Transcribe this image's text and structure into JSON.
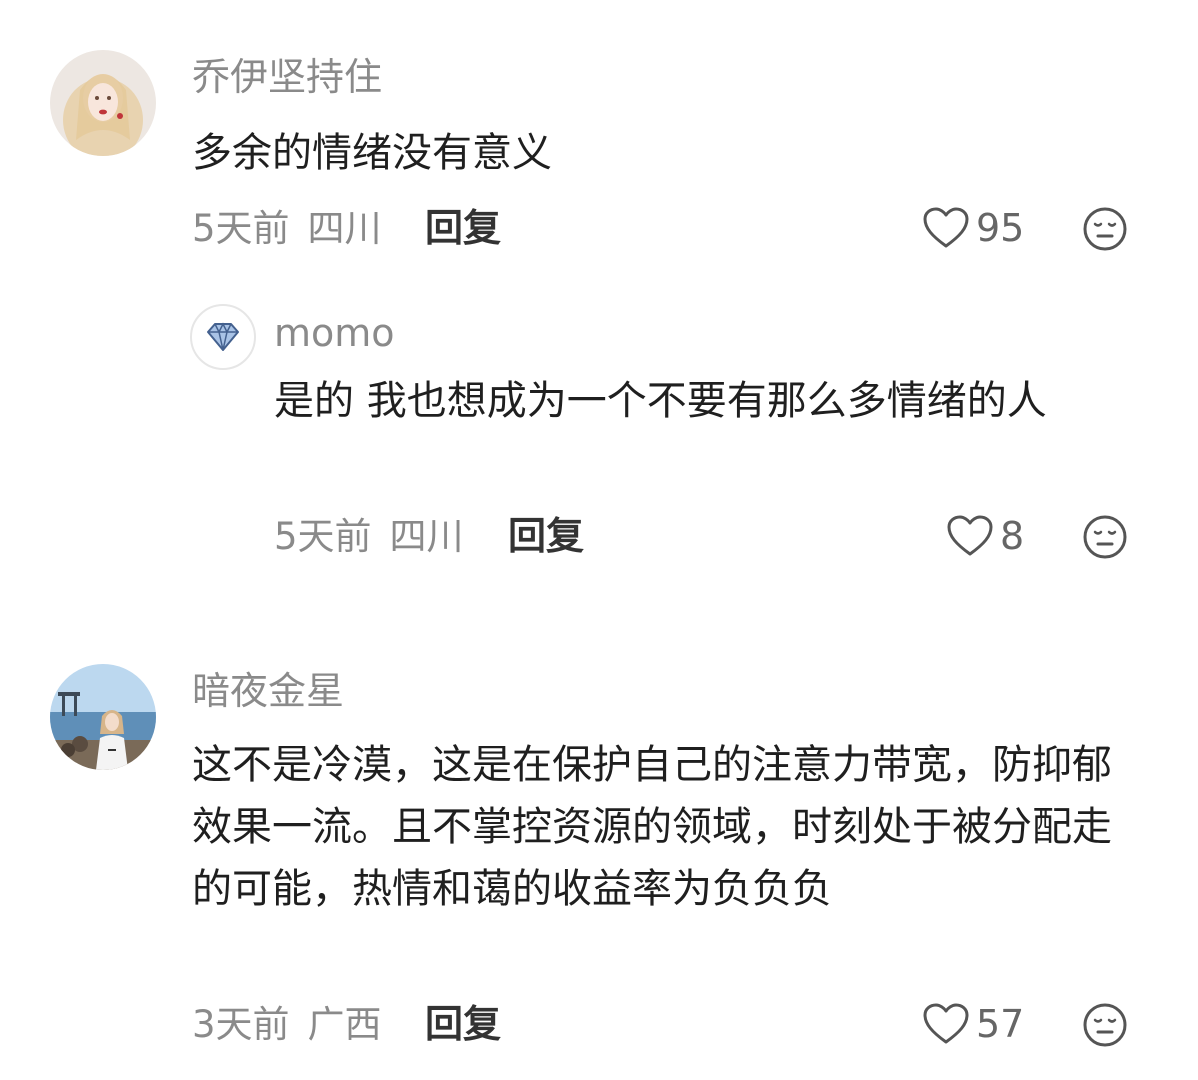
{
  "comments": [
    {
      "username": "乔伊坚持住",
      "text": "多余的情绪没有意义",
      "time": "5天前",
      "location": "四川",
      "reply_label": "回复",
      "likes": "95",
      "replies": [
        {
          "username": "momo",
          "text": "是的 我也想成为一个不要有那么多情绪的人",
          "time": "5天前",
          "location": "四川",
          "reply_label": "回复",
          "likes": "8"
        }
      ]
    },
    {
      "username": "暗夜金星",
      "text": "这不是冷漠，这是在保护自己的注意力带宽，防抑郁效果一流。且不掌控资源的领域，时刻处于被分配走的可能，热情和蔼的收益率为负负负",
      "time": "3天前",
      "location": "广西",
      "reply_label": "回复",
      "likes": "57"
    }
  ],
  "icons": {
    "like": "heart-outline-icon",
    "dislike": "neutral-face-icon",
    "reply_avatar": "diamond-icon"
  },
  "colors": {
    "username": "#8a8a8a",
    "text": "#1f1f1f",
    "meta": "#8a8a8a",
    "icon": "#555555"
  }
}
